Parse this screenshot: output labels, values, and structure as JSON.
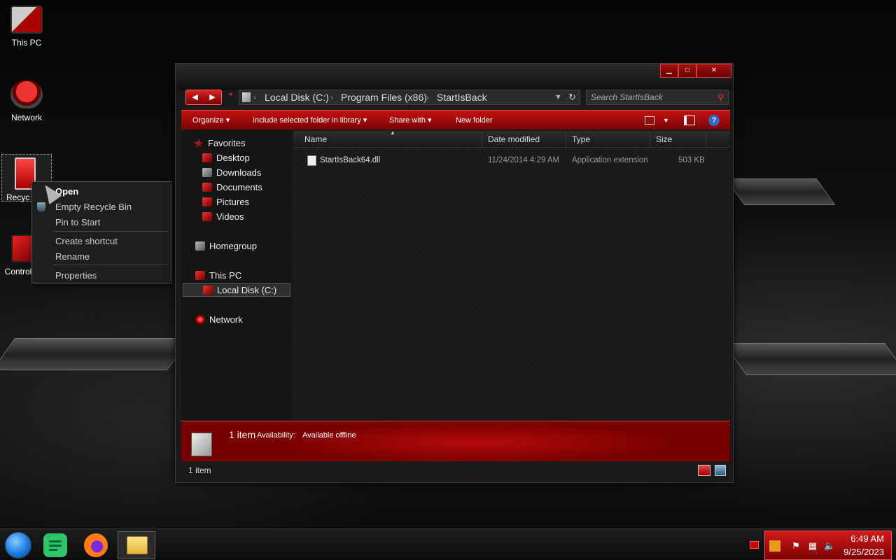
{
  "desktop": {
    "icons": [
      {
        "label": "This PC"
      },
      {
        "label": "Network"
      },
      {
        "label": "Recyc"
      },
      {
        "label": "Control"
      }
    ]
  },
  "context_menu": {
    "items": [
      "Open",
      "Empty Recycle Bin",
      "Pin to Start",
      "Create shortcut",
      "Rename",
      "Properties"
    ]
  },
  "explorer": {
    "caption_buttons": {
      "minimize": "▁",
      "maximize": "□",
      "close": "✕"
    },
    "nav": {
      "back": "◀",
      "forward": "▶",
      "recent": "▾"
    },
    "address": {
      "segments": [
        "Local Disk (C:)",
        "Program Files (x86)",
        "StartIsBack"
      ],
      "separator": "›"
    },
    "search_placeholder": "Search StartIsBack",
    "toolbar": {
      "organize": "Organize ▾",
      "include": "Include selected folder in library ▾",
      "share": "Share with ▾",
      "new_folder": "New folder",
      "help": "?"
    },
    "nav_pane": {
      "favorites": "Favorites",
      "desktop": "Desktop",
      "downloads": "Downloads",
      "documents": "Documents",
      "pictures": "Pictures",
      "videos": "Videos",
      "homegroup": "Homegroup",
      "this_pc": "This PC",
      "local_disk": "Local Disk (C:)",
      "network": "Network"
    },
    "columns": {
      "name": "Name",
      "date": "Date modified",
      "type": "Type",
      "size": "Size"
    },
    "files": [
      {
        "name": "StartIsBack64.dll",
        "date": "11/24/2014 4:29 AM",
        "type": "Application extension",
        "size": "503 KB"
      }
    ],
    "details_pane": {
      "count": "1 item",
      "availability_label": "Availability:",
      "availability_value": "Available offline"
    },
    "status": "1 item"
  },
  "taskbar": {
    "time": "6:49 AM",
    "date": "9/25/2023"
  },
  "colors": {
    "accent": "#c41212",
    "dark": "#1a1a1a"
  }
}
